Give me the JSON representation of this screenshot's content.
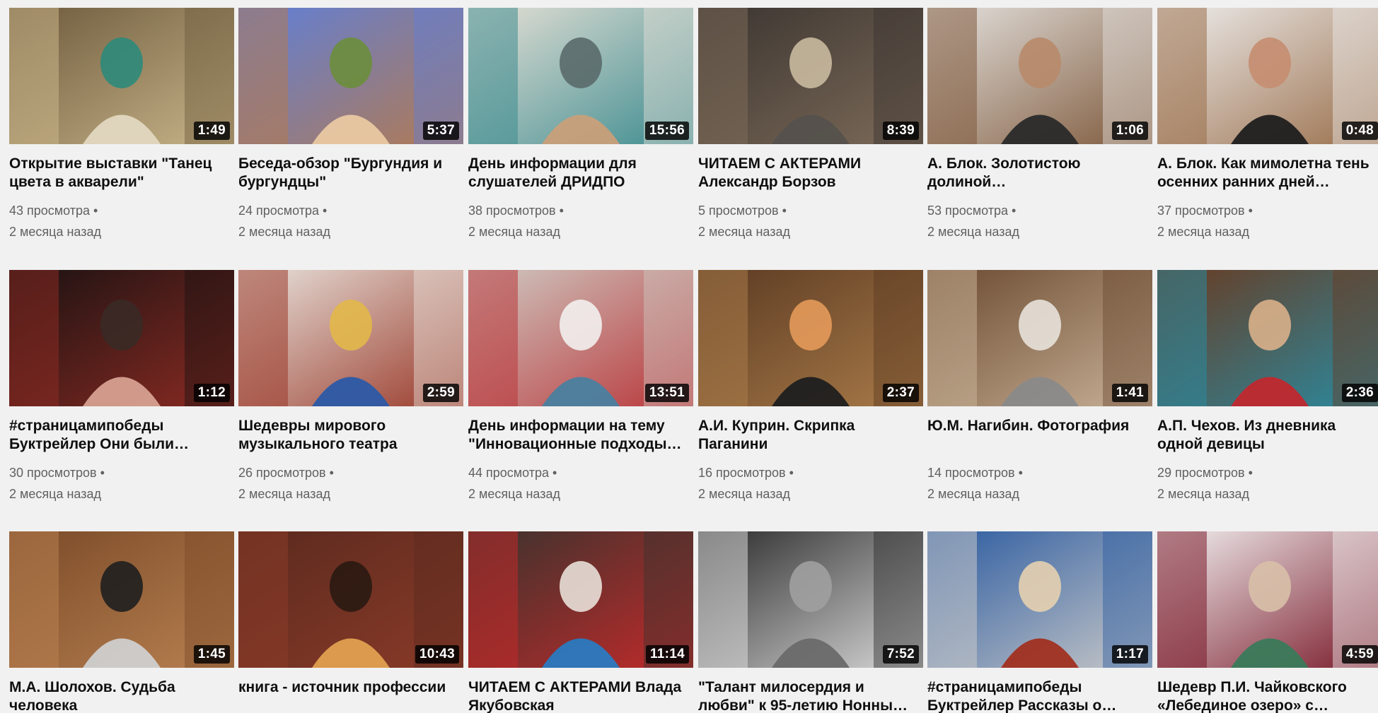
{
  "videos": [
    {
      "title": "Открытие выставки \"Танец цвета в акварели\"",
      "duration": "1:49",
      "views": "43 просмотра",
      "age": "2 месяца назад",
      "palette": [
        "#6d5a3c",
        "#c8b489",
        "#e2d7c0",
        "#2e8a7a"
      ]
    },
    {
      "title": "Беседа-обзор \"Бургундия и бургундцы\"",
      "duration": "5:37",
      "views": "24 просмотра",
      "age": "2 месяца назад",
      "palette": [
        "#5f7fd9",
        "#b27a52",
        "#e9c9a2",
        "#6c8e3c"
      ]
    },
    {
      "title": "День информации для слушателей ДРИДПО",
      "duration": "15:56",
      "views": "38 просмотров",
      "age": "2 месяца назад",
      "palette": [
        "#e7e1d6",
        "#3e8c90",
        "#c99f7a",
        "#5a6a6a"
      ]
    },
    {
      "title": "ЧИТАЕМ С АКТЕРАМИ Александр Борзов",
      "duration": "8:39",
      "views": "5 просмотров",
      "age": "2 месяца назад",
      "palette": [
        "#3a3430",
        "#7c6a58",
        "#55514c",
        "#c9b9a0"
      ]
    },
    {
      "title": "А. Блок. Золотистою долиной…",
      "duration": "1:06",
      "views": "53 просмотра",
      "age": "2 месяца назад",
      "palette": [
        "#e4e2df",
        "#7f5a3c",
        "#2a2a2a",
        "#b88a6a"
      ]
    },
    {
      "title": "А. Блок. Как мимолетна тень осенних ранних дней…",
      "duration": "0:48",
      "views": "37 просмотров",
      "age": "2 месяца назад",
      "palette": [
        "#eeeeee",
        "#9a6f4b",
        "#1f1f1f",
        "#c58d70"
      ]
    },
    {
      "title": "#страницамипобеды Буктрейлер Они были…",
      "duration": "1:12",
      "views": "30 просмотров",
      "age": "2 месяца назад",
      "palette": [
        "#1a1212",
        "#8a2a22",
        "#d6a090",
        "#3a2a26"
      ]
    },
    {
      "title": "Шедевры мирового музыкального театра",
      "duration": "2:59",
      "views": "26 просмотров",
      "age": "2 месяца назад",
      "palette": [
        "#e8e4de",
        "#9a3a2a",
        "#2c5aa6",
        "#e2b84a"
      ]
    },
    {
      "title": "День информации на тему \"Инновационные подходы…",
      "duration": "13:51",
      "views": "44 просмотра",
      "age": "2 месяца назад",
      "palette": [
        "#cfcac3",
        "#b9373a",
        "#4a7fa0",
        "#f2f0ee"
      ]
    },
    {
      "title": "А.И. Куприн. Скрипка Паганини",
      "duration": "2:37",
      "views": "16 просмотров",
      "age": "2 месяца назад",
      "palette": [
        "#5b3a22",
        "#a87a48",
        "#1f1f1f",
        "#e49a5a"
      ]
    },
    {
      "title": "Ю.М. Нагибин. Фотография",
      "duration": "1:41",
      "views": "14 просмотров",
      "age": "2 месяца назад",
      "palette": [
        "#6b4a30",
        "#c7b096",
        "#8a8a8a",
        "#e8e2da"
      ]
    },
    {
      "title": "А.П. Чехов. Из дневника одной девицы",
      "duration": "2:36",
      "views": "29 просмотров",
      "age": "2 месяца назад",
      "palette": [
        "#6a3a20",
        "#2a8aa0",
        "#c0282e",
        "#d9b08a"
      ]
    },
    {
      "title": "М.А. Шолохов. Судьба человека",
      "duration": "1:45",
      "views": "",
      "age": "",
      "palette": [
        "#7a4a28",
        "#b88050",
        "#cfcfcf",
        "#1f1f1f"
      ]
    },
    {
      "title": "книга - источник профессии",
      "duration": "10:43",
      "views": "",
      "age": "",
      "palette": [
        "#5a2a1e",
        "#8a3a28",
        "#e2a050",
        "#2a1a12"
      ]
    },
    {
      "title": "ЧИТАЕМ С АКТЕРАМИ Влада Якубовская",
      "duration": "11:14",
      "views": "",
      "age": "",
      "palette": [
        "#3a332e",
        "#c02a2a",
        "#2a7ac0",
        "#e8e0d8"
      ]
    },
    {
      "title": "\"Талант милосердия и любви\" к 95-летию Нонны…",
      "duration": "7:52",
      "views": "",
      "age": "",
      "palette": [
        "#2a2a2a",
        "#d8d8d8",
        "#6a6a6a",
        "#a0a0a0"
      ]
    },
    {
      "title": "#страницамипобеды Буктрейлер Рассказы о…",
      "duration": "1:17",
      "views": "",
      "age": "",
      "palette": [
        "#2a5aa0",
        "#c8c8c8",
        "#a03020",
        "#e6d0b0"
      ]
    },
    {
      "title": "Шедевр П.И. Чайковского «Лебединое озеро» с…",
      "duration": "4:59",
      "views": "",
      "age": "",
      "palette": [
        "#f2f2f2",
        "#7a1a2a",
        "#3a7a5a",
        "#d8c0a8"
      ]
    }
  ]
}
